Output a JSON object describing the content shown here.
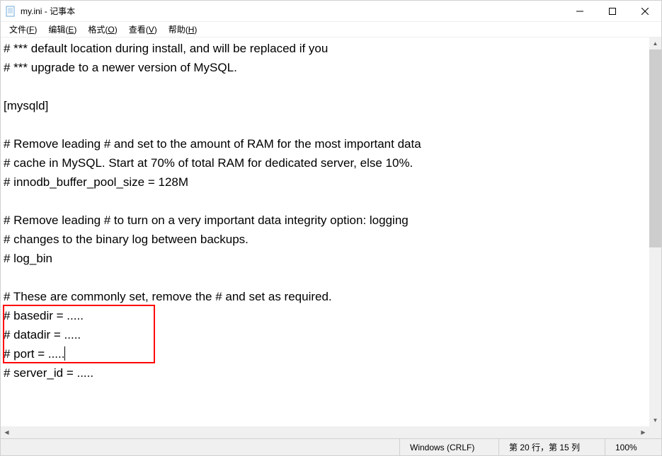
{
  "titlebar": {
    "title": "my.ini - 记事本"
  },
  "menu": {
    "file": "文件(F)",
    "edit": "编辑(E)",
    "format": "格式(O)",
    "view": "查看(V)",
    "help": "帮助(H)"
  },
  "content": {
    "lines": [
      "# *** default location during install, and will be replaced if you",
      "# *** upgrade to a newer version of MySQL.",
      "",
      "[mysqld]",
      "",
      "# Remove leading # and set to the amount of RAM for the most important data",
      "# cache in MySQL. Start at 70% of total RAM for dedicated server, else 10%.",
      "# innodb_buffer_pool_size = 128M",
      "",
      "# Remove leading # to turn on a very important data integrity option: logging",
      "# changes to the binary log between backups.",
      "# log_bin",
      "",
      "# These are commonly set, remove the # and set as required.",
      "# basedir = .....",
      "# datadir = .....",
      "# port = .....",
      "# server_id = .....",
      ""
    ],
    "caret_line_index": 16,
    "caret_prefix": "# port = ....."
  },
  "statusbar": {
    "encoding": "Windows (CRLF)",
    "position": "第 20 行，第 15 列",
    "zoom": "100%"
  }
}
